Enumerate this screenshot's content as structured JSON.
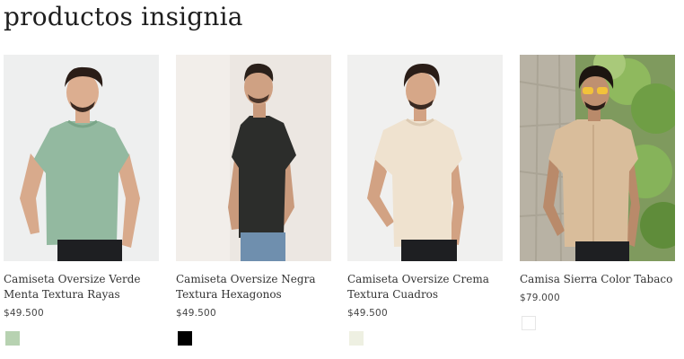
{
  "section": {
    "title": "productos insignia"
  },
  "products": [
    {
      "name": "Camiseta Oversize Verde Menta Textura Rayas",
      "price": "$49.500",
      "swatch_color": "#b7d2b1",
      "shirt_color": "#93b9a0",
      "bg_color": "#eeefef"
    },
    {
      "name": "Camiseta Oversize Negra Textura Hexagonos",
      "price": "$49.500",
      "swatch_color": "#000000",
      "shirt_color": "#2c2d2b",
      "bg_color": "#ece7e2"
    },
    {
      "name": "Camiseta Oversize Crema Textura Cuadros",
      "price": "$49.500",
      "swatch_color": "#eef0e2",
      "shirt_color": "#efe2cf",
      "bg_color": "#f0f0ef"
    },
    {
      "name": "Camisa Sierra Color Tabaco",
      "price": "$79.000",
      "swatch_color": "#ffffff",
      "shirt_color": "#d9bd9b",
      "bg_color": "#7f9a5e"
    }
  ]
}
